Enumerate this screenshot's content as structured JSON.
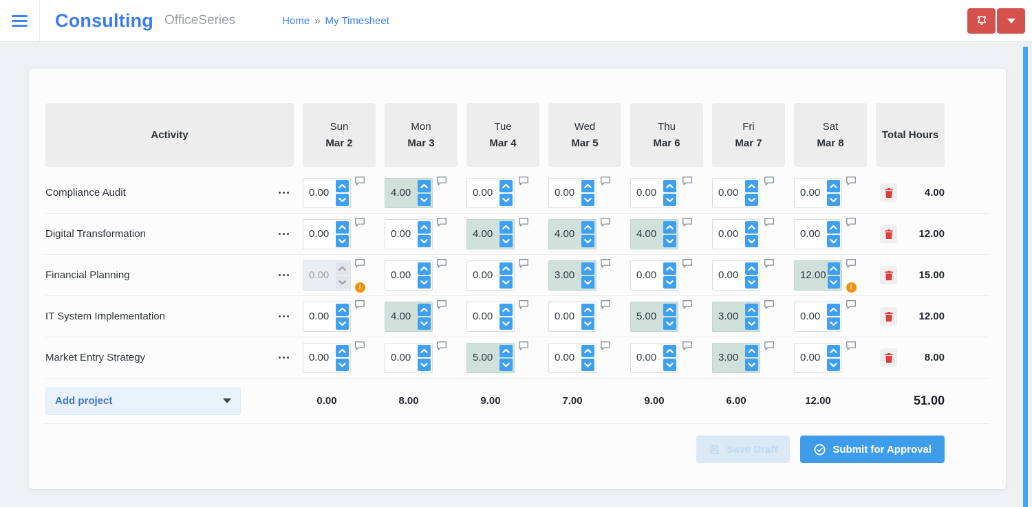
{
  "header": {
    "app_title": "Consulting",
    "suite_name": "OfficeSeries",
    "breadcrumb": {
      "home": "Home",
      "separator": "»",
      "current": "My Timesheet"
    }
  },
  "icons": {
    "menu": "hamburger-icon",
    "notifications": "bell-icon",
    "user_menu": "caret-down-icon",
    "row_menu": "ellipsis-icon",
    "comment": "speech-bubble-icon",
    "warning": "orange-info-icon",
    "delete": "trash-icon",
    "increment": "chevron-up-icon",
    "decrement": "chevron-down-icon",
    "save": "floppy-disk-icon",
    "submit": "check-circle-icon"
  },
  "colors": {
    "accent_blue": "#3f9ceb",
    "brand_blue": "#3b7bf2",
    "spinner_blue": "#3fa0f1",
    "header_red": "#d4514c",
    "filled_cell_bg": "#cfe1da",
    "disabled_cell_bg": "#eaedf1",
    "warning_orange": "#f79009",
    "trash_red": "#e23b3b",
    "scrollbar_blue": "#42a4f5",
    "page_bg": "#eef0f4"
  },
  "table": {
    "activity_header": "Activity",
    "total_header": "Total Hours",
    "days": [
      {
        "name": "Sun",
        "date": "Mar 2"
      },
      {
        "name": "Mon",
        "date": "Mar 3"
      },
      {
        "name": "Tue",
        "date": "Mar 4"
      },
      {
        "name": "Wed",
        "date": "Mar 5"
      },
      {
        "name": "Thu",
        "date": "Mar 6"
      },
      {
        "name": "Fri",
        "date": "Mar 7"
      },
      {
        "name": "Sat",
        "date": "Mar 8"
      }
    ],
    "rows": [
      {
        "activity": "Compliance Audit",
        "cells": [
          {
            "value": "0.00",
            "state": "normal",
            "warning": false
          },
          {
            "value": "4.00",
            "state": "filled",
            "warning": false
          },
          {
            "value": "0.00",
            "state": "normal",
            "warning": false
          },
          {
            "value": "0.00",
            "state": "normal",
            "warning": false
          },
          {
            "value": "0.00",
            "state": "normal",
            "warning": false
          },
          {
            "value": "0.00",
            "state": "normal",
            "warning": false
          },
          {
            "value": "0.00",
            "state": "normal",
            "warning": false
          }
        ],
        "total": "4.00"
      },
      {
        "activity": "Digital Transformation",
        "cells": [
          {
            "value": "0.00",
            "state": "normal",
            "warning": false
          },
          {
            "value": "0.00",
            "state": "normal",
            "warning": false
          },
          {
            "value": "4.00",
            "state": "filled",
            "warning": false
          },
          {
            "value": "4.00",
            "state": "filled",
            "warning": false
          },
          {
            "value": "4.00",
            "state": "filled",
            "warning": false
          },
          {
            "value": "0.00",
            "state": "normal",
            "warning": false
          },
          {
            "value": "0.00",
            "state": "normal",
            "warning": false
          }
        ],
        "total": "12.00"
      },
      {
        "activity": "Financial Planning",
        "cells": [
          {
            "value": "0.00",
            "state": "disabled",
            "warning": true
          },
          {
            "value": "0.00",
            "state": "normal",
            "warning": false
          },
          {
            "value": "0.00",
            "state": "normal",
            "warning": false
          },
          {
            "value": "3.00",
            "state": "filled",
            "warning": false
          },
          {
            "value": "0.00",
            "state": "normal",
            "warning": false
          },
          {
            "value": "0.00",
            "state": "normal",
            "warning": false
          },
          {
            "value": "12.00",
            "state": "filled",
            "warning": true
          }
        ],
        "total": "15.00"
      },
      {
        "activity": "IT System Implementation",
        "cells": [
          {
            "value": "0.00",
            "state": "normal",
            "warning": false
          },
          {
            "value": "4.00",
            "state": "filled",
            "warning": false
          },
          {
            "value": "0.00",
            "state": "normal",
            "warning": false
          },
          {
            "value": "0.00",
            "state": "normal",
            "warning": false
          },
          {
            "value": "5.00",
            "state": "filled",
            "warning": false
          },
          {
            "value": "3.00",
            "state": "filled",
            "warning": false
          },
          {
            "value": "0.00",
            "state": "normal",
            "warning": false
          }
        ],
        "total": "12.00"
      },
      {
        "activity": "Market Entry Strategy",
        "cells": [
          {
            "value": "0.00",
            "state": "normal",
            "warning": false
          },
          {
            "value": "0.00",
            "state": "normal",
            "warning": false
          },
          {
            "value": "5.00",
            "state": "filled",
            "warning": false
          },
          {
            "value": "0.00",
            "state": "normal",
            "warning": false
          },
          {
            "value": "0.00",
            "state": "normal",
            "warning": false
          },
          {
            "value": "3.00",
            "state": "filled",
            "warning": false
          },
          {
            "value": "0.00",
            "state": "normal",
            "warning": false
          }
        ],
        "total": "8.00"
      }
    ],
    "footer": {
      "add_project_label": "Add project",
      "day_totals": [
        "0.00",
        "8.00",
        "9.00",
        "7.00",
        "9.00",
        "6.00",
        "12.00"
      ],
      "grand_total": "51.00"
    }
  },
  "actions": {
    "save_draft": "Save Draft",
    "submit": "Submit for Approval"
  }
}
